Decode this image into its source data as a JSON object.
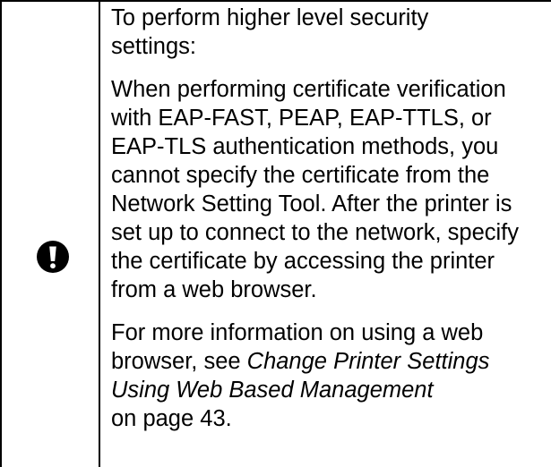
{
  "note": {
    "icon": "exclamation-alert-icon",
    "paragraphs": [
      {
        "lines": [
          "To perform higher level security",
          "settings:"
        ]
      },
      {
        "lines": [
          "When performing certificate verification",
          "with EAP-FAST, PEAP, EAP-TTLS, or",
          "EAP-TLS authentication methods, you",
          "cannot specify the certificate from the",
          "Network Setting Tool. After the printer is",
          "set up to connect to the network, specify",
          "the certificate by accessing the printer",
          "from a web browser."
        ]
      },
      {
        "line_1": "For more information on using a web",
        "line_2_plain": "browser, see ",
        "line_2_italic": "Change Printer Settings",
        "line_3_italic": "Using Web Based Management",
        "line_4": "on page 43."
      }
    ]
  }
}
